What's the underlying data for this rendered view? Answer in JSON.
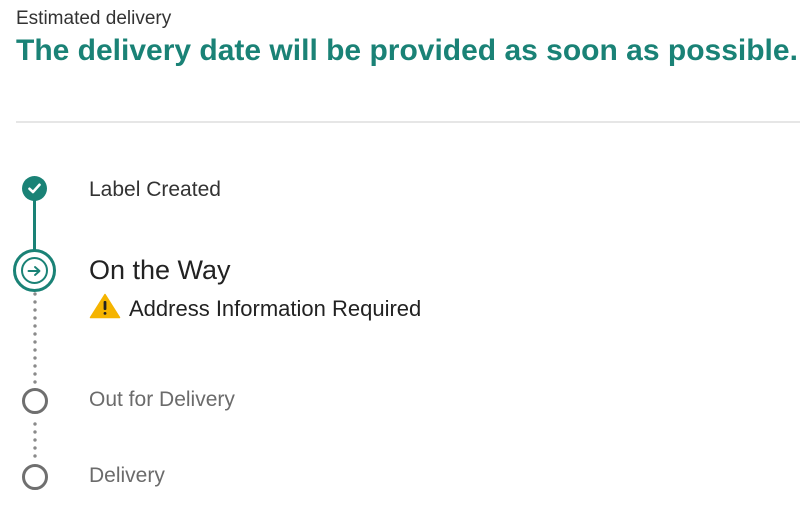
{
  "delivery": {
    "estimated_label": "Estimated delivery",
    "estimated_value": "The delivery date will be provided as soon as possible."
  },
  "colors": {
    "accent": "#1a8276",
    "warning": "#f5b400",
    "pending": "#6f6f6f"
  },
  "timeline": {
    "steps": [
      {
        "label": "Label Created",
        "status": "completed",
        "icon": "check-icon"
      },
      {
        "label": "On the Way",
        "status": "current",
        "icon": "arrow-right-icon",
        "alert": {
          "icon": "warning-icon",
          "text": "Address Information Required"
        }
      },
      {
        "label": "Out for Delivery",
        "status": "pending",
        "icon": "empty-circle-icon"
      },
      {
        "label": "Delivery",
        "status": "pending",
        "icon": "empty-circle-icon"
      }
    ]
  }
}
